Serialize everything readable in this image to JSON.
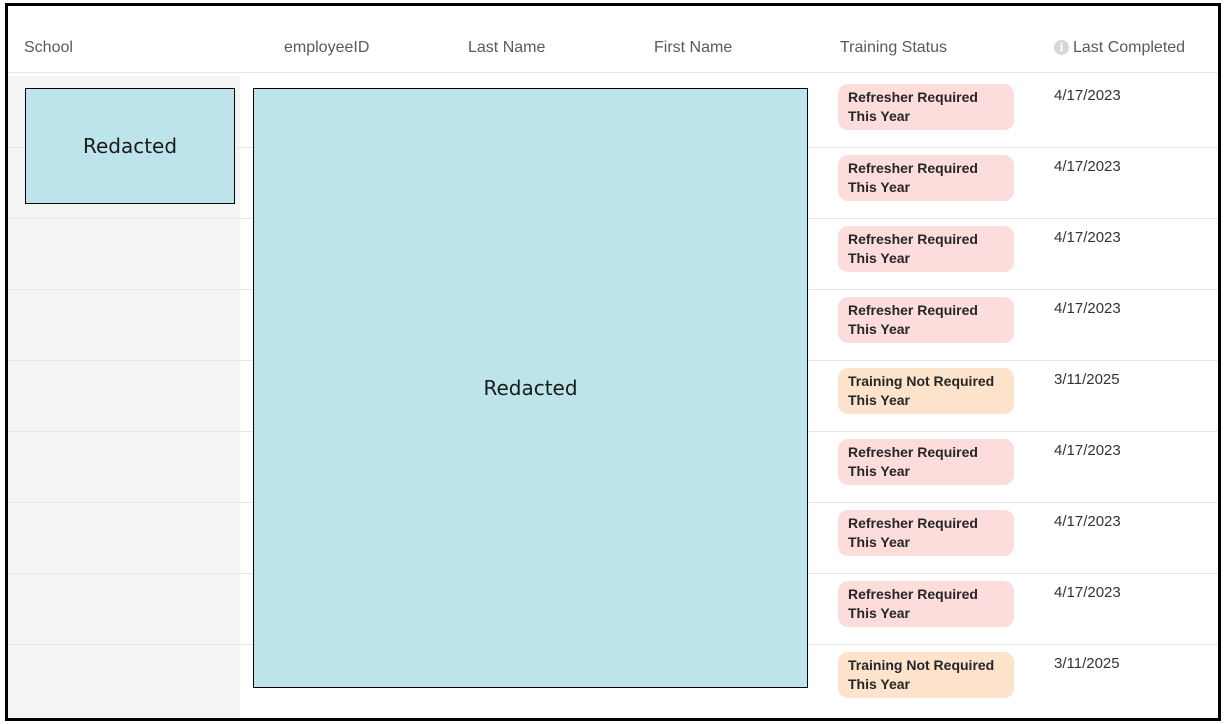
{
  "headers": {
    "school": "School",
    "employee_id": "employeeID",
    "last_name": "Last Name",
    "first_name": "First Name",
    "training_status": "Training Status",
    "last_completed": "Last Completed"
  },
  "info_icon_glyph": "i",
  "redacted": {
    "school": "Redacted",
    "employee_block": "Redacted"
  },
  "colors": {
    "refresher_badge": "#fddcdc",
    "not_required_badge": "#fde3cc",
    "redaction_fill": "#bde4ea"
  },
  "rows": [
    {
      "status": "Refresher Required This Year",
      "status_kind": "refresh",
      "last_completed": "4/17/2023"
    },
    {
      "status": "Refresher Required This Year",
      "status_kind": "refresh",
      "last_completed": "4/17/2023"
    },
    {
      "status": "Refresher Required This Year",
      "status_kind": "refresh",
      "last_completed": "4/17/2023"
    },
    {
      "status": "Refresher Required This Year",
      "status_kind": "refresh",
      "last_completed": "4/17/2023"
    },
    {
      "status": "Training Not Required This Year",
      "status_kind": "notreq",
      "last_completed": "3/11/2025"
    },
    {
      "status": "Refresher Required This Year",
      "status_kind": "refresh",
      "last_completed": "4/17/2023"
    },
    {
      "status": "Refresher Required This Year",
      "status_kind": "refresh",
      "last_completed": "4/17/2023"
    },
    {
      "status": "Refresher Required This Year",
      "status_kind": "refresh",
      "last_completed": "4/17/2023"
    },
    {
      "status": "Training Not Required This Year",
      "status_kind": "notreq",
      "last_completed": "3/11/2025"
    }
  ]
}
